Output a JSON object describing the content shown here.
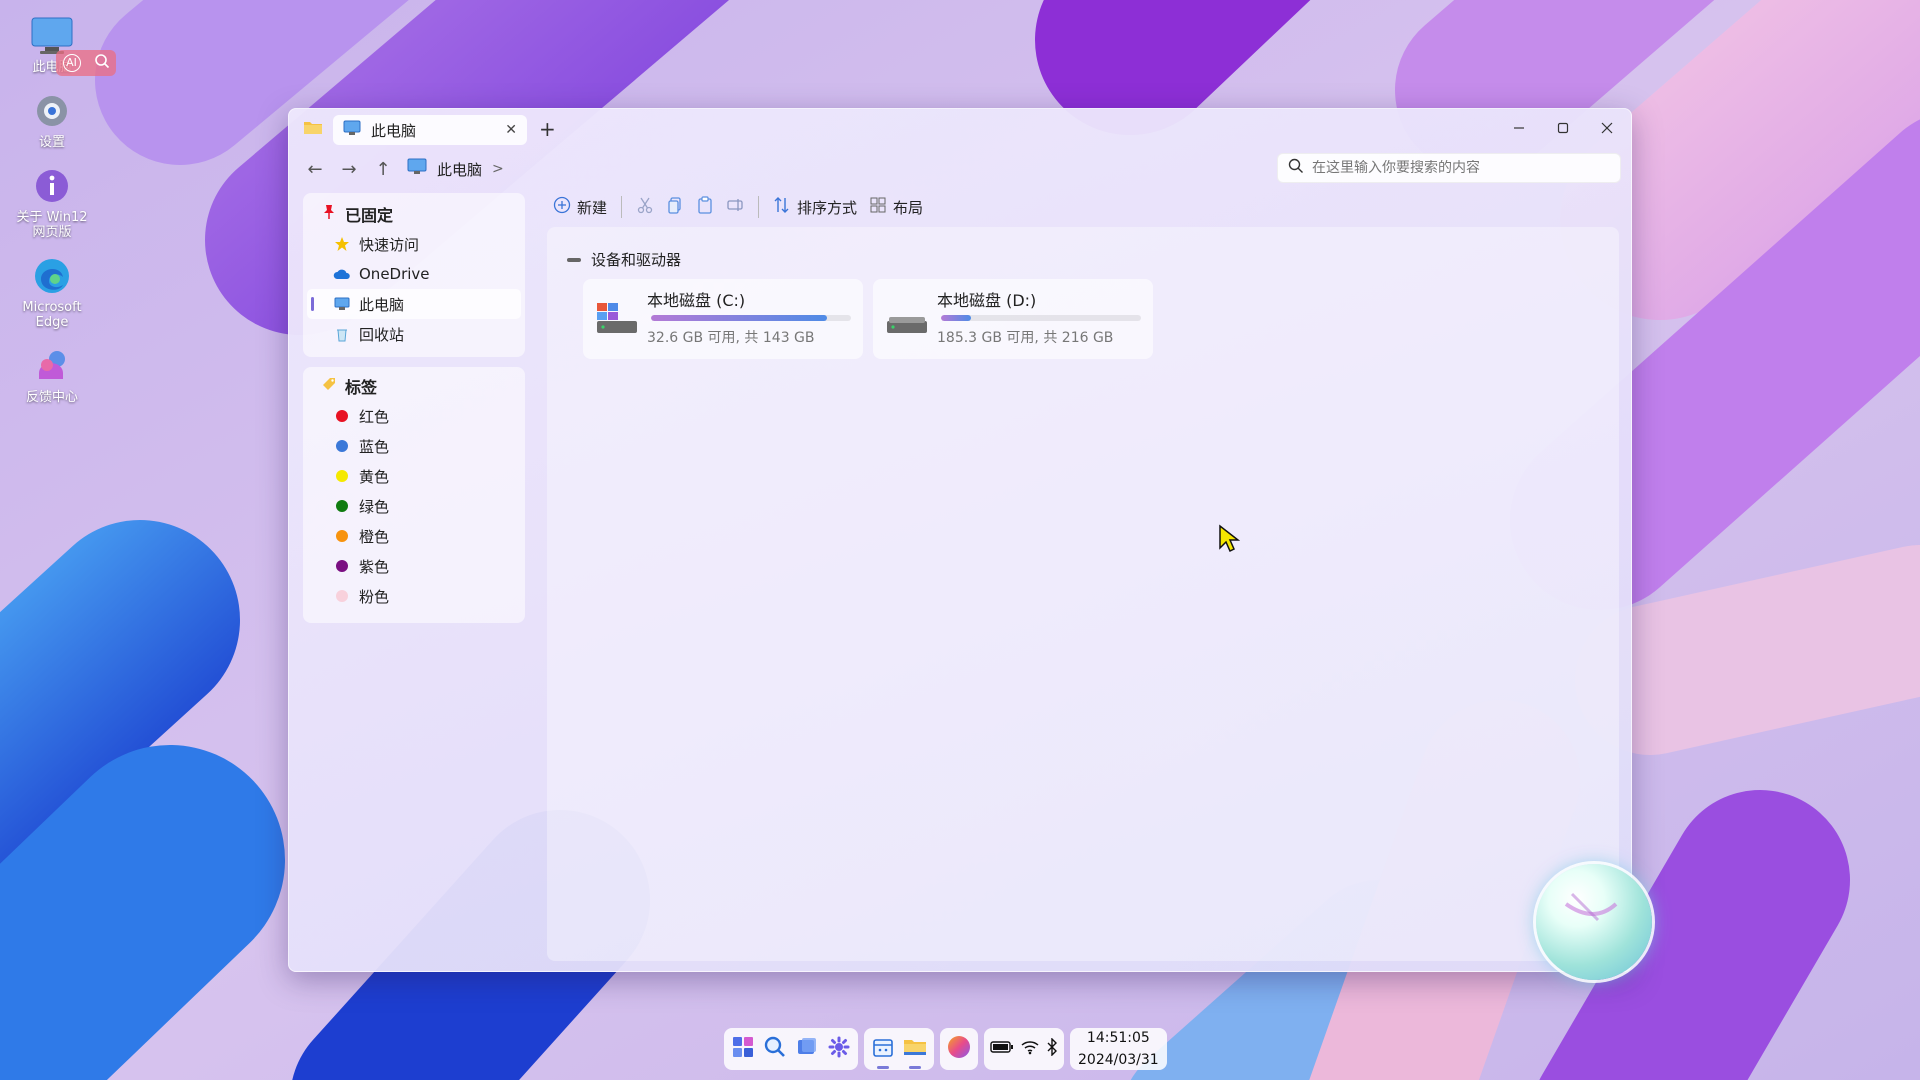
{
  "desktop": {
    "icons": [
      {
        "label": "此电脑",
        "icon": "monitor-icon"
      },
      {
        "label": "设置",
        "icon": "gear-icon"
      },
      {
        "label": "关于 Win12 网页版",
        "icon": "info-icon"
      },
      {
        "label": "Microsoft Edge",
        "icon": "edge-icon"
      },
      {
        "label": "反馈中心",
        "icon": "feedback-icon"
      }
    ],
    "badge": {
      "left": "AI",
      "right": "search-icon"
    }
  },
  "window": {
    "app_icon": "folder-icon",
    "tab_title": "此电脑",
    "new_tab": "+",
    "controls": {
      "minimize": "minimize-icon",
      "maximize": "maximize-icon",
      "close": "close-icon"
    }
  },
  "nav": {
    "back": "←",
    "forward": "→",
    "up": "↑",
    "breadcrumb": "此电脑",
    "breadcrumb_sep": ">",
    "search_placeholder": "在这里输入你要搜索的内容"
  },
  "toolbar": {
    "new_label": "新建",
    "sort_label": "排序方式",
    "layout_label": "布局"
  },
  "sidebar": {
    "pinned_title": "已固定",
    "pinned_items": [
      {
        "label": "快速访问",
        "icon": "star-icon"
      },
      {
        "label": "OneDrive",
        "icon": "cloud-icon"
      },
      {
        "label": "此电脑",
        "icon": "monitor-icon",
        "active": true
      },
      {
        "label": "回收站",
        "icon": "recycle-bin-icon"
      }
    ],
    "tags_title": "标签",
    "tags": [
      {
        "label": "红色",
        "color": "#e81123"
      },
      {
        "label": "蓝色",
        "color": "#3b78d8"
      },
      {
        "label": "黄色",
        "color": "#f5e900"
      },
      {
        "label": "绿色",
        "color": "#107c10"
      },
      {
        "label": "橙色",
        "color": "#f7930e"
      },
      {
        "label": "紫色",
        "color": "#7a0f82"
      },
      {
        "label": "粉色",
        "color": "#f8d1dc"
      }
    ]
  },
  "main": {
    "section_title": "设备和驱动器",
    "drives": [
      {
        "name": "本地磁盘 (C:)",
        "info": "32.6 GB 可用, 共 143 GB",
        "used_fraction": 0.88
      },
      {
        "name": "本地磁盘 (D:)",
        "info": "185.3 GB 可用, 共 216 GB",
        "used_fraction": 0.15
      }
    ]
  },
  "taskbar": {
    "time": "14:51:05",
    "date": "2024/03/31"
  }
}
